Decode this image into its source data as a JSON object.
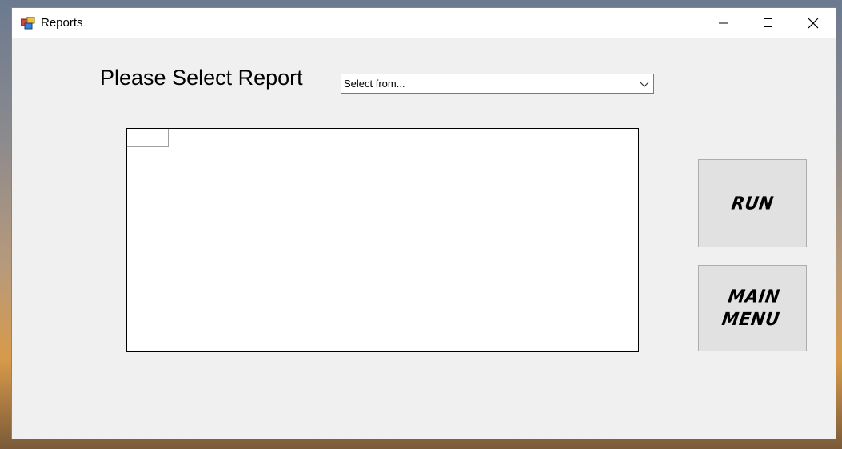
{
  "window": {
    "title": "Reports",
    "app_icon": "forms-app-icon",
    "controls": {
      "minimize_icon": "minimize-icon",
      "maximize_icon": "maximize-icon",
      "close_icon": "close-icon"
    }
  },
  "form": {
    "prompt_label": "Please Select Report",
    "report_select": {
      "value": "Select from...",
      "icon": "chevron-down-icon"
    }
  },
  "buttons": {
    "run_label": "RUN",
    "main_menu_label": "MAIN\nMENU"
  },
  "colors": {
    "window_bg": "#f0f0f0",
    "titlebar_bg": "#ffffff",
    "button_bg": "#e1e1e1",
    "window_border": "#5b8ec9"
  }
}
